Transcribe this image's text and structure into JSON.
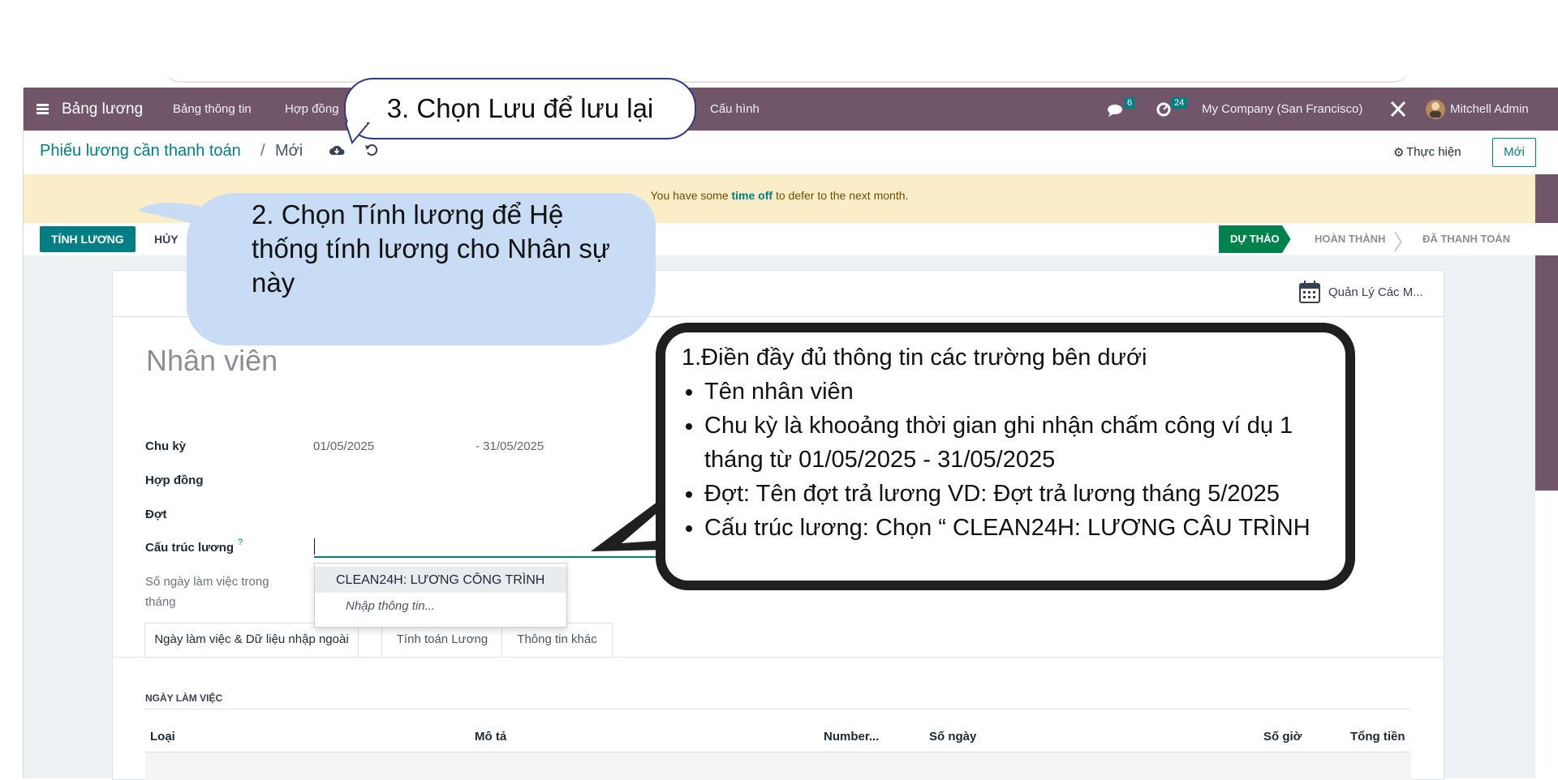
{
  "navbar": {
    "app_name": "Bảng lương",
    "menus": [
      "Bảng thông tin",
      "Hợp đồng",
      "Cấu hình"
    ],
    "messages_badge": "6",
    "activity_badge": "24",
    "company": "My Company (San Francisco)",
    "user": "Mitchell Admin"
  },
  "control_panel": {
    "breadcrumb_parent": "Phiếu lương cần thanh toán",
    "breadcrumb_current": "Mới",
    "action_label": "Thực hiện",
    "new_button": "Mới"
  },
  "banner": {
    "prefix": "You have some",
    "link": "time off",
    "suffix": "to defer to the next month."
  },
  "statusbar": {
    "compute_button": "TÍNH LƯƠNG",
    "cancel_button": "HỦY",
    "stages": [
      "DỰ THẢO",
      "HOÀN THÀNH",
      "ĐÃ THANH TOÁN"
    ],
    "active_stage": "DỰ THẢO"
  },
  "sheet": {
    "smart_button": "Quản Lý Các M...",
    "employee_placeholder": "Nhân viên",
    "fields": {
      "period_label": "Chu kỳ",
      "period_start": "01/05/2025",
      "period_end": "- 31/05/2025",
      "contract_label": "Hợp đồng",
      "batch_label": "Đợt",
      "structure_label": "Cấu trúc lương",
      "structure_help": "?",
      "workdays_label_1": "Số ngày làm việc trong",
      "workdays_label_2": "tháng"
    },
    "dropdown": {
      "option": "CLEAN24H: LƯƠNG CÔNG TRÌNH",
      "search_more": "Nhập thông tin..."
    },
    "tabs": [
      "Ngày làm việc & Dữ liệu nhập ngoài",
      "Tính toán Lương",
      "Thông tin khác"
    ],
    "section_title": "NGÀY LÀM VIỆC",
    "table_headers": [
      "Loại",
      "Mô tả",
      "Number...",
      "Số ngày",
      "Số giờ",
      "Tổng tiền"
    ]
  },
  "callouts": {
    "save": "3. Chọn Lưu để lưu lại",
    "compute": "2. Chọn Tính lương để Hệ thống tính lương cho Nhân sự này",
    "fill_title": "1.Điền đầy đủ thông tin các trường bên dưới",
    "fill_items": [
      "Tên nhân viên",
      "Chu kỳ là khooảng thời gian ghi nhận chấm công ví dụ 1 tháng từ 01/05/2025 - 31/05/2025",
      "Đợt: Tên đợt trả lương VD: Đợt trả lương tháng 5/2025",
      "Cấu trúc lương: Chọn “ CLEAN24H: LƯƠNG CÂU TRÌNH"
    ]
  },
  "colors": {
    "navbar": "#71566a",
    "primary": "#017e84",
    "banner": "#fbedc7",
    "active_stage": "#00814e"
  }
}
